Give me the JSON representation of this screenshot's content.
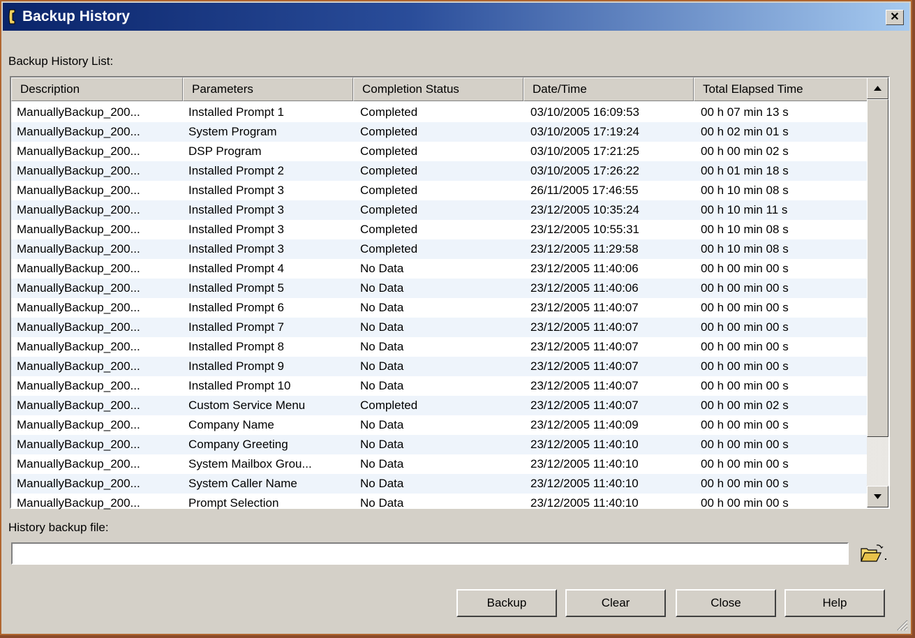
{
  "window": {
    "title": "Backup History",
    "close_label": "✕"
  },
  "list": {
    "label": "Backup History List:",
    "columns": [
      "Description",
      "Parameters",
      "Completion Status",
      "Date/Time",
      "Total Elapsed Time"
    ],
    "rows": [
      [
        "ManuallyBackup_200...",
        "Installed Prompt 1",
        "Completed",
        "03/10/2005 16:09:53",
        "00 h 07 min 13 s"
      ],
      [
        "ManuallyBackup_200...",
        "System Program",
        "Completed",
        "03/10/2005 17:19:24",
        "00 h 02 min 01 s"
      ],
      [
        "ManuallyBackup_200...",
        "DSP Program",
        "Completed",
        "03/10/2005 17:21:25",
        "00 h 00 min 02 s"
      ],
      [
        "ManuallyBackup_200...",
        "Installed Prompt 2",
        "Completed",
        "03/10/2005 17:26:22",
        "00 h 01 min 18 s"
      ],
      [
        "ManuallyBackup_200...",
        "Installed Prompt 3",
        "Completed",
        "26/11/2005 17:46:55",
        "00 h 10 min 08 s"
      ],
      [
        "ManuallyBackup_200...",
        "Installed Prompt 3",
        "Completed",
        "23/12/2005 10:35:24",
        "00 h 10 min 11 s"
      ],
      [
        "ManuallyBackup_200...",
        "Installed Prompt 3",
        "Completed",
        "23/12/2005 10:55:31",
        "00 h 10 min 08 s"
      ],
      [
        "ManuallyBackup_200...",
        "Installed Prompt 3",
        "Completed",
        "23/12/2005 11:29:58",
        "00 h 10 min 08 s"
      ],
      [
        "ManuallyBackup_200...",
        "Installed Prompt 4",
        "No Data",
        "23/12/2005 11:40:06",
        "00 h 00 min 00 s"
      ],
      [
        "ManuallyBackup_200...",
        "Installed Prompt 5",
        "No Data",
        "23/12/2005 11:40:06",
        "00 h 00 min 00 s"
      ],
      [
        "ManuallyBackup_200...",
        "Installed Prompt 6",
        "No Data",
        "23/12/2005 11:40:07",
        "00 h 00 min 00 s"
      ],
      [
        "ManuallyBackup_200...",
        "Installed Prompt 7",
        "No Data",
        "23/12/2005 11:40:07",
        "00 h 00 min 00 s"
      ],
      [
        "ManuallyBackup_200...",
        "Installed Prompt 8",
        "No Data",
        "23/12/2005 11:40:07",
        "00 h 00 min 00 s"
      ],
      [
        "ManuallyBackup_200...",
        "Installed Prompt 9",
        "No Data",
        "23/12/2005 11:40:07",
        "00 h 00 min 00 s"
      ],
      [
        "ManuallyBackup_200...",
        "Installed Prompt 10",
        "No Data",
        "23/12/2005 11:40:07",
        "00 h 00 min 00 s"
      ],
      [
        "ManuallyBackup_200...",
        "Custom Service Menu",
        "Completed",
        "23/12/2005 11:40:07",
        "00 h 00 min 02 s"
      ],
      [
        "ManuallyBackup_200...",
        "Company Name",
        "No Data",
        "23/12/2005 11:40:09",
        "00 h 00 min 00 s"
      ],
      [
        "ManuallyBackup_200...",
        "Company Greeting",
        "No Data",
        "23/12/2005 11:40:10",
        "00 h 00 min 00 s"
      ],
      [
        "ManuallyBackup_200...",
        "System Mailbox Grou...",
        "No Data",
        "23/12/2005 11:40:10",
        "00 h 00 min 00 s"
      ],
      [
        "ManuallyBackup_200...",
        "System Caller Name",
        "No Data",
        "23/12/2005 11:40:10",
        "00 h 00 min 00 s"
      ],
      [
        "ManuallyBackup_200...",
        "Prompt Selection",
        "No Data",
        "23/12/2005 11:40:10",
        "00 h 00 min 00 s"
      ]
    ]
  },
  "file": {
    "label": "History backup file:",
    "value": ""
  },
  "buttons": {
    "backup": "Backup",
    "clear": "Clear",
    "close": "Close",
    "help": "Help"
  },
  "icons": {
    "title": "phone-icon",
    "browse": "folder-open-icon",
    "scroll_up": "arrow-up-icon",
    "scroll_down": "arrow-down-icon",
    "resize": "resize-grip-icon"
  }
}
